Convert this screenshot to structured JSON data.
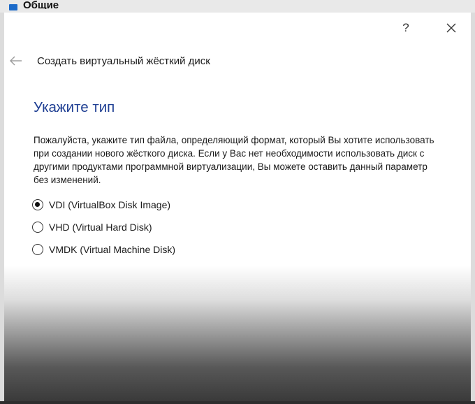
{
  "parent_window": {
    "title": "Общие",
    "icon": "settings-category-icon"
  },
  "dialog": {
    "help_label": "?",
    "close_icon": "close-icon",
    "back_icon": "arrow-left-icon",
    "wizard_title": "Создать виртуальный жёсткий диск",
    "heading": "Укажите тип",
    "description": "Пожалуйста, укажите тип файла, определяющий формат, который Вы хотите использовать при создании нового жёсткого диска. Если у Вас нет необходимости использовать диск с другими продуктами программной виртуализации, Вы можете оставить данный параметр без изменений.",
    "options": [
      {
        "label": "VDI (VirtualBox Disk Image)",
        "checked": true
      },
      {
        "label": "VHD (Virtual Hard Disk)",
        "checked": false
      },
      {
        "label": "VMDK (Virtual Machine Disk)",
        "checked": false
      }
    ]
  },
  "colors": {
    "heading": "#1f3f93",
    "parent_icon": "#1b6ac9"
  }
}
